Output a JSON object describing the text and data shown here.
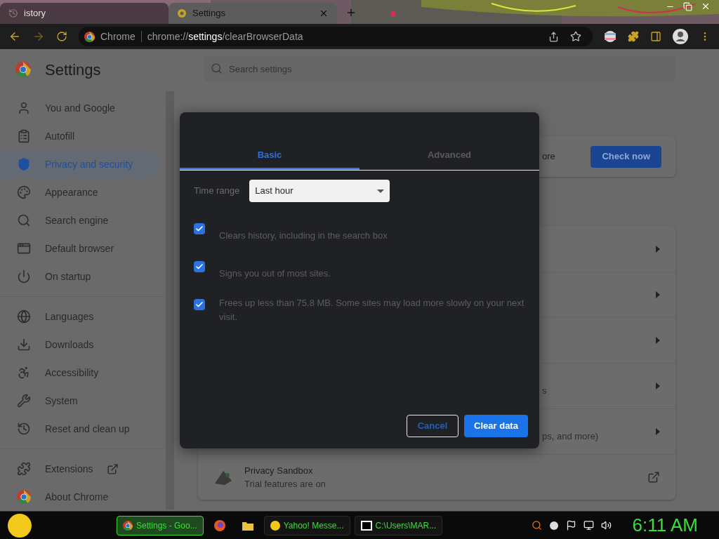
{
  "browser": {
    "tabs": [
      {
        "title": "istory",
        "selected": false
      },
      {
        "title": "Settings",
        "selected": true
      }
    ],
    "address": {
      "site": "Chrome",
      "url": "chrome://**settings**/clearBrowserData"
    }
  },
  "settings": {
    "title": "Settings",
    "search": {
      "placeholder": "Search settings"
    },
    "sidebar": {
      "groups": [
        [
          {
            "label": "You and Google",
            "selected": false,
            "kind": "page"
          },
          {
            "label": "Autofill",
            "selected": false,
            "kind": "page"
          },
          {
            "label": "Privacy and security",
            "selected": true,
            "kind": "page"
          },
          {
            "label": "Appearance",
            "selected": false,
            "kind": "page"
          },
          {
            "label": "Search engine",
            "selected": false,
            "kind": "page"
          },
          {
            "label": "Default browser",
            "selected": false,
            "kind": "page"
          },
          {
            "label": "On startup",
            "selected": false,
            "kind": "page"
          }
        ],
        [
          {
            "label": "Languages",
            "selected": false,
            "kind": "page"
          },
          {
            "label": "Downloads",
            "selected": false,
            "kind": "page"
          },
          {
            "label": "Accessibility",
            "selected": false,
            "kind": "page"
          },
          {
            "label": "System",
            "selected": false,
            "kind": "page"
          },
          {
            "label": "Reset and clean up",
            "selected": false,
            "kind": "page"
          }
        ],
        [
          {
            "label": "Extensions",
            "selected": false,
            "kind": "external"
          },
          {
            "label": "About Chrome",
            "selected": false,
            "kind": "page"
          }
        ]
      ]
    },
    "safety_card": {
      "text": "ore",
      "button": "Check now"
    },
    "privacy_rows": [
      {
        "kind": "chevron"
      },
      {
        "kind": "chevron"
      },
      {
        "kind": "chevron"
      },
      {
        "kind": "chevron",
        "subtitle": "s"
      },
      {
        "kind": "chevron",
        "subtitle": "ps, and more)"
      },
      {
        "kind": "external",
        "title": "Privacy Sandbox",
        "subtitle": "Trial features are on"
      }
    ]
  },
  "dialog": {
    "tabs": [
      {
        "label": "Basic",
        "selected": true
      },
      {
        "label": "Advanced",
        "selected": false
      }
    ],
    "time_range": {
      "label": "Time range",
      "value": "Last hour"
    },
    "options": [
      {
        "text": "Clears history, including in the search box",
        "checked": true
      },
      {
        "text": "Signs you out of most sites.",
        "checked": true
      },
      {
        "text": "Frees up less than 75.8 MB. Some sites may load more slowly on your next visit.",
        "checked": true
      }
    ],
    "buttons": {
      "cancel": "Cancel",
      "confirm": "Clear data"
    }
  },
  "taskbar": {
    "items": [
      {
        "label": "Settings - Goo...",
        "selected": true
      },
      {
        "selected": false
      },
      {
        "selected": false
      },
      {
        "label": "Yahoo! Messe...",
        "selected": false
      },
      {
        "label": "C:\\Users\\MAR...",
        "selected": false
      }
    ],
    "clock": "6:11 AM"
  }
}
